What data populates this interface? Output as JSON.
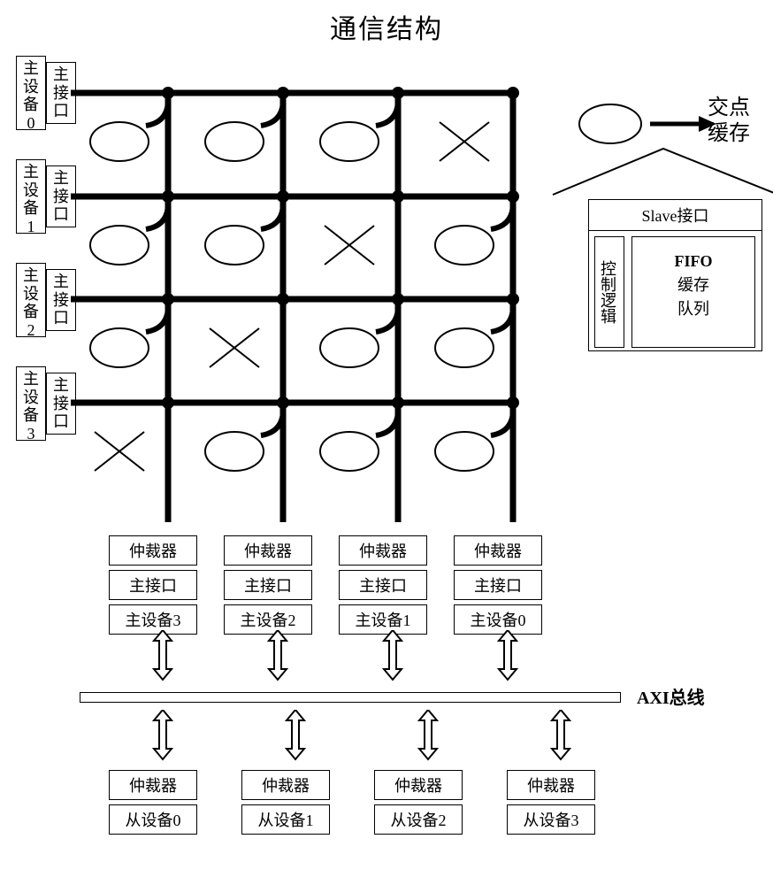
{
  "title": "通信结构",
  "masters": [
    {
      "device": "主设备0",
      "port": "主接口"
    },
    {
      "device": "主设备1",
      "port": "主接口"
    },
    {
      "device": "主设备2",
      "port": "主接口"
    },
    {
      "device": "主设备3",
      "port": "主接口"
    }
  ],
  "arbiters_top": [
    {
      "arb": "仲裁器",
      "port": "主接口",
      "dev": "主设备3"
    },
    {
      "arb": "仲裁器",
      "port": "主接口",
      "dev": "主设备2"
    },
    {
      "arb": "仲裁器",
      "port": "主接口",
      "dev": "主设备1"
    },
    {
      "arb": "仲裁器",
      "port": "主接口",
      "dev": "主设备0"
    }
  ],
  "arbiters_bottom": [
    {
      "arb": "仲裁器",
      "dev": "从设备0"
    },
    {
      "arb": "仲裁器",
      "dev": "从设备1"
    },
    {
      "arb": "仲裁器",
      "dev": "从设备2"
    },
    {
      "arb": "仲裁器",
      "dev": "从设备3"
    }
  ],
  "axi_label": "AXI总线",
  "legend": {
    "crosspoint_cache": "交点缓存",
    "slave_port": "Slave接口",
    "control_logic": "控制逻辑",
    "fifo_cache": "FIFO缓存队列"
  },
  "grid": {
    "rows": 4,
    "cols": 4,
    "connections": [
      [
        true,
        true,
        true,
        false
      ],
      [
        true,
        true,
        false,
        true
      ],
      [
        true,
        false,
        true,
        true
      ],
      [
        false,
        true,
        true,
        true
      ]
    ]
  },
  "chart_data": {
    "type": "diagram",
    "description": "Crossbar communication structure: 4 master devices on left each with a master interface, connected via a 4x4 crosspoint grid (ellipses = crosspoint cache connections, X = no connection) to 4 arbiter/master-interface/master-device columns, through bidirectional arrows to an AXI bus, then via bidirectional arrows to 4 arbiter/slave-device blocks. Legend on right shows crosspoint cache detail (Slave interface containing control logic and FIFO cache queue).",
    "crossbar_matrix_rows_masters_cols_slaves": [
      [
        1,
        1,
        1,
        0
      ],
      [
        1,
        1,
        0,
        1
      ],
      [
        1,
        0,
        1,
        1
      ],
      [
        0,
        1,
        1,
        1
      ]
    ]
  }
}
